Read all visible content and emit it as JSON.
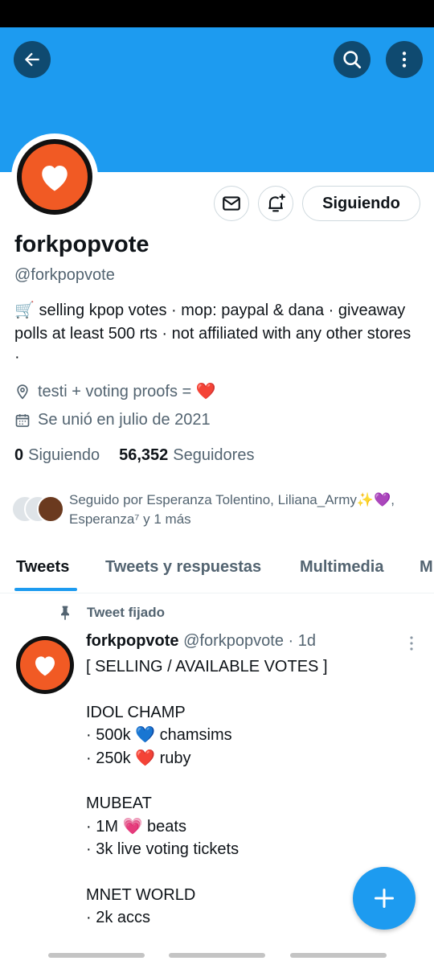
{
  "header": {
    "back_icon": "back-arrow-icon",
    "search_icon": "search-icon",
    "more_icon": "more-vertical-icon",
    "banner_color": "#1d9bf0"
  },
  "profile": {
    "avatar_colors": {
      "ring": "#111111",
      "fill": "#f15a24",
      "heart": "#ffffff"
    },
    "actions": {
      "message_icon": "mail-icon",
      "notify_icon": "bell-plus-icon",
      "follow_label": "Siguiendo"
    },
    "display_name": "forkpopvote",
    "handle": "@forkpopvote",
    "bio": "🛒 selling kpop votes · mop: paypal & dana · giveaway polls at least 500 rts · not affiliated with any other stores ·",
    "location": "testi + voting proofs = ❤️",
    "joined": "Se unió en julio de 2021",
    "following_count": "0",
    "following_label": "Siguiendo",
    "followers_count": "56,352",
    "followers_label": "Seguidores",
    "followed_by": "Seguido por Esperanza Tolentino, Liliana_Army✨💜, Esperanza⁷ y 1 más"
  },
  "tabs": [
    {
      "label": "Tweets",
      "active": true
    },
    {
      "label": "Tweets y respuestas",
      "active": false
    },
    {
      "label": "Multimedia",
      "active": false
    },
    {
      "label": "M",
      "active": false
    }
  ],
  "pinned_tweet": {
    "pinned_label": "Tweet fijado",
    "author_name": "forkpopvote",
    "author_handle": "@forkpopvote",
    "time": "· 1d",
    "text": "[ SELLING / AVAILABLE VOTES ]\n\nIDOL CHAMP\n· 500k 💙 chamsims\n· 250k ❤️ ruby\n\nMUBEAT\n· 1M 💗 beats\n· 3k live voting tickets\n\nMNET WORLD\n· 2k accs"
  },
  "fab": {
    "icon": "plus-icon",
    "accent": "#1d9bf0"
  }
}
